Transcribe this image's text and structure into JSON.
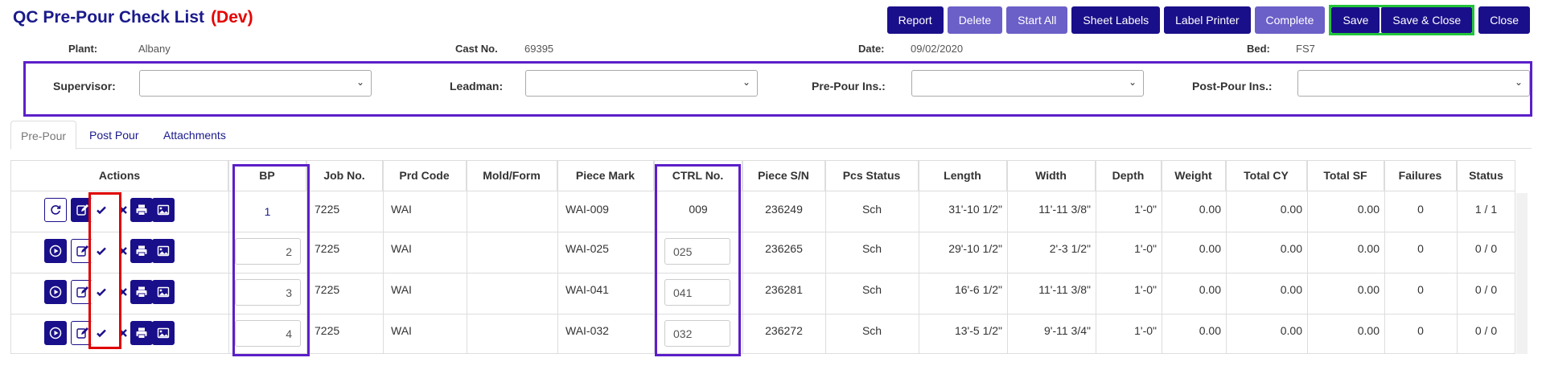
{
  "page": {
    "title": "QC Pre-Pour Check List",
    "env": "(Dev)"
  },
  "toolbar": {
    "report": "Report",
    "delete": "Delete",
    "start_all": "Start All",
    "sheet_labels": "Sheet Labels",
    "label_printer": "Label Printer",
    "complete": "Complete",
    "save": "Save",
    "save_close": "Save & Close",
    "close": "Close"
  },
  "info": {
    "plant_label": "Plant:",
    "plant_value": "Albany",
    "cast_label": "Cast No.",
    "cast_value": "69395",
    "date_label": "Date:",
    "date_value": "09/02/2020",
    "bed_label": "Bed:",
    "bed_value": "FS7"
  },
  "roles": {
    "supervisor": "Supervisor:",
    "leadman": "Leadman:",
    "prepour": "Pre-Pour Ins.:",
    "postpour": "Post-Pour Ins.:"
  },
  "tabs": [
    "Pre-Pour",
    "Post Pour",
    "Attachments"
  ],
  "grid": {
    "headers": [
      "Actions",
      "BP",
      "Job No.",
      "Prd Code",
      "Mold/Form",
      "Piece Mark",
      "CTRL No.",
      "Piece S/N",
      "Pcs Status",
      "Length",
      "Width",
      "Depth",
      "Weight",
      "Total CY",
      "Total SF",
      "Failures",
      "Status"
    ],
    "rows": [
      {
        "bp": "1",
        "job": "7225",
        "prd": "WAI",
        "mold": "",
        "mark": "WAI-009",
        "ctrl": "009",
        "sn": "236249",
        "pstatus": "Sch",
        "length": "31'-10 1/2\"",
        "width": "11'-11 3/8\"",
        "depth": "1'-0\"",
        "weight": "0.00",
        "cy": "0.00",
        "sf": "0.00",
        "failures": "0",
        "status": "1 / 1"
      },
      {
        "bp": "2",
        "job": "7225",
        "prd": "WAI",
        "mold": "",
        "mark": "WAI-025",
        "ctrl": "025",
        "sn": "236265",
        "pstatus": "Sch",
        "length": "29'-10 1/2\"",
        "width": "2'-3 1/2\"",
        "depth": "1'-0\"",
        "weight": "0.00",
        "cy": "0.00",
        "sf": "0.00",
        "failures": "0",
        "status": "0 / 0"
      },
      {
        "bp": "3",
        "job": "7225",
        "prd": "WAI",
        "mold": "",
        "mark": "WAI-041",
        "ctrl": "041",
        "sn": "236281",
        "pstatus": "Sch",
        "length": "16'-6 1/2\"",
        "width": "11'-11 3/8\"",
        "depth": "1'-0\"",
        "weight": "0.00",
        "cy": "0.00",
        "sf": "0.00",
        "failures": "0",
        "status": "0 / 0"
      },
      {
        "bp": "4",
        "job": "7225",
        "prd": "WAI",
        "mold": "",
        "mark": "WAI-032",
        "ctrl": "032",
        "sn": "236272",
        "pstatus": "Sch",
        "length": "13'-5 1/2\"",
        "width": "9'-11 3/4\"",
        "depth": "1'-0\"",
        "weight": "0.00",
        "cy": "0.00",
        "sf": "0.00",
        "failures": "0",
        "status": "0 / 0"
      }
    ]
  },
  "colors": {
    "primary": "#1a0f8a",
    "primary_light": "#6b5fc8",
    "highlight_purple": "#5c1fc9",
    "highlight_red": "#e00000",
    "highlight_green": "#22c43a",
    "dev_red": "#e60000"
  }
}
